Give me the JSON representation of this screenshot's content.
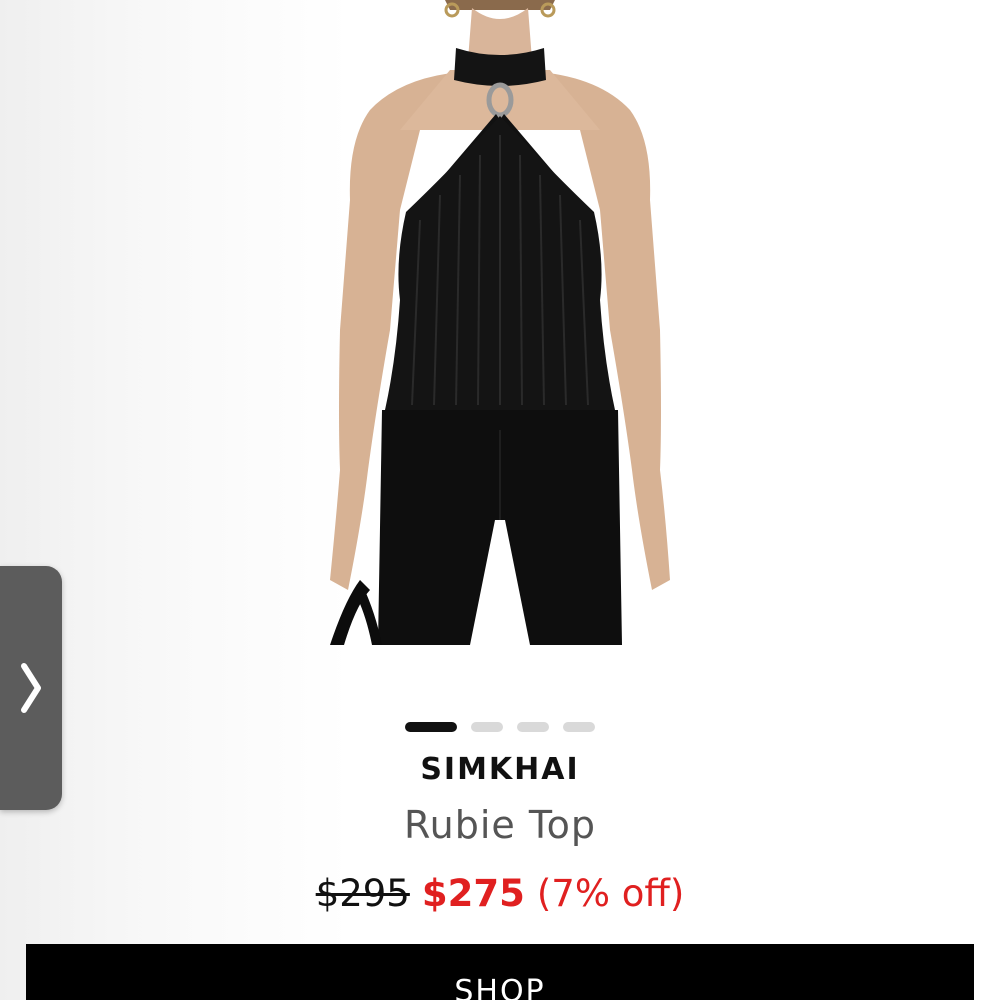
{
  "product": {
    "brand": "SIMKHAI",
    "name": "Rubie Top",
    "original_price": "$295",
    "sale_price": "$275",
    "discount": "(7% off)"
  },
  "carousel": {
    "total_slides": 4,
    "active_slide": 1
  },
  "side_tab": {
    "icon": "chevron-right-icon"
  },
  "actions": {
    "shop_label": "SHOP"
  },
  "colors": {
    "sale_red": "#e02020",
    "button_black": "#000000",
    "dot_active": "#111111",
    "dot_inactive": "#d9d9d9"
  }
}
